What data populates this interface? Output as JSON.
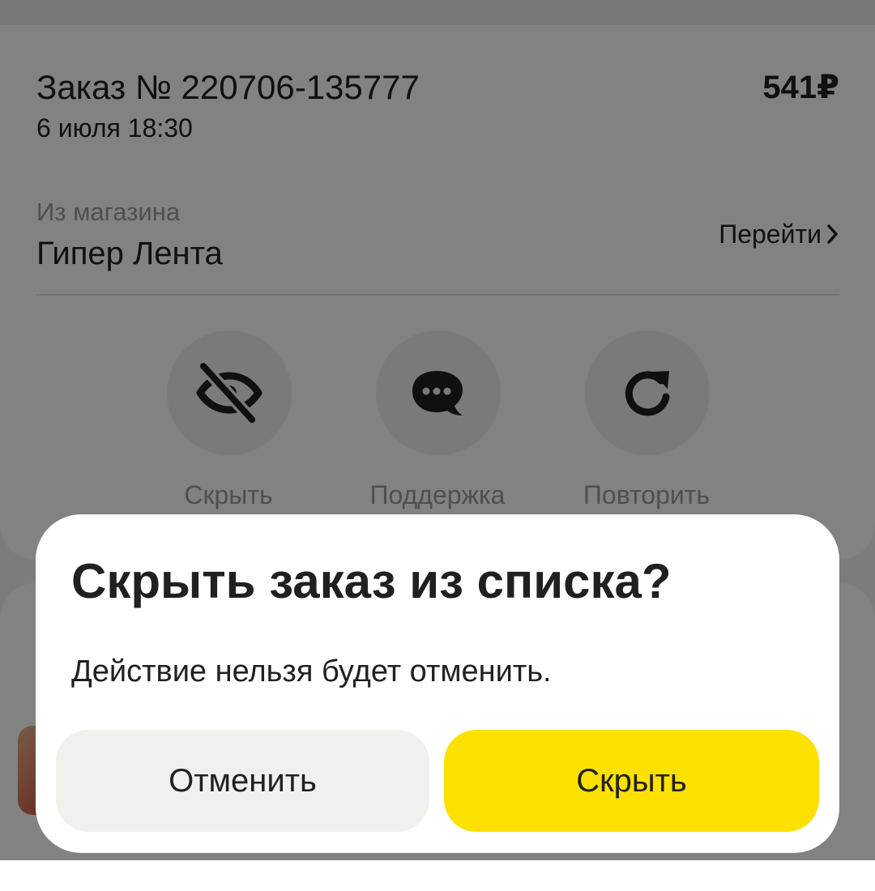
{
  "order": {
    "title": "Заказ № 220706-135777",
    "date": "6 июля 18:30",
    "price": "541₽",
    "store_caption": "Из магазина",
    "store_name": "Гипер Лента",
    "goto_label": "Перейти"
  },
  "actions": [
    {
      "label": "Скрыть",
      "icon": "eye-off-icon"
    },
    {
      "label": "Поддержка",
      "icon": "chat-bubble-icon"
    },
    {
      "label": "Повторить",
      "icon": "refresh-icon"
    }
  ],
  "dialog": {
    "title": "Скрыть заказ из списка?",
    "text": "Действие нельзя будет отменить.",
    "cancel_label": "Отменить",
    "confirm_label": "Скрыть"
  },
  "colors": {
    "accent": "#fce000",
    "secondary_button": "#f1f0ed",
    "text": "#21201f",
    "muted_text": "#9e9b98",
    "overlay": "rgba(0,0,0,0.49)"
  }
}
